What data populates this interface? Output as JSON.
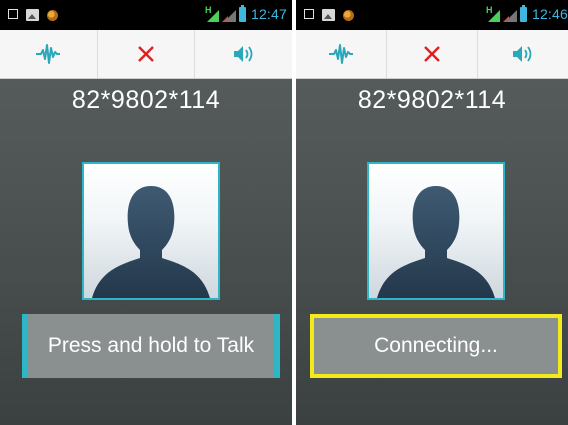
{
  "left_screen": {
    "status_bar": {
      "time": "12:47",
      "network_label": "H"
    },
    "phone_number": "82*9802*114",
    "talk_button_label": "Press and hold to Talk"
  },
  "right_screen": {
    "status_bar": {
      "time": "12:46",
      "network_label": "H"
    },
    "phone_number": "82*9802*114",
    "talk_button_label": "Connecting..."
  },
  "icons": {
    "toolbar": [
      "waveform-icon",
      "close-icon",
      "speaker-icon"
    ],
    "status_left": [
      "notification-square-icon",
      "gallery-icon",
      "app-notification-icon"
    ],
    "status_right": [
      "network-h-signal-icon",
      "signal-strength-icon",
      "battery-icon"
    ]
  },
  "colors": {
    "accent_teal": "#2db7c6",
    "close_red": "#e02020",
    "highlight_yellow": "#f2ea1a",
    "status_time_blue": "#3fb8e0"
  }
}
